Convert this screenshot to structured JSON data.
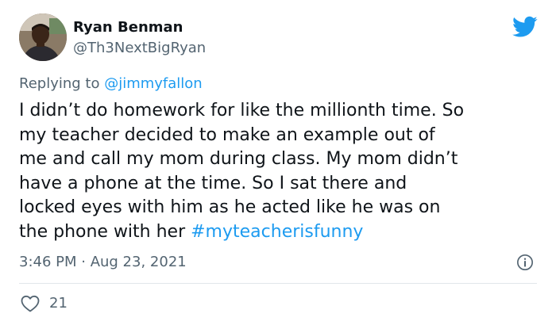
{
  "author": {
    "name": "Ryan Benman",
    "handle": "@Th3NextBigRyan"
  },
  "reply": {
    "prefix": "Replying to ",
    "mention": "@jimmyfallon"
  },
  "tweet": {
    "lines": [
      "I didn’t do homework for like the millionth time. So",
      "my teacher decided to make an example out of",
      "me and call my mom during class. My mom didn’t",
      "have a phone at the time. So I sat there and",
      "locked eyes with him as he acted like he was on",
      "the phone with her "
    ],
    "hashtag": "#myteacherisfunny"
  },
  "timestamp": "3:46 PM · Aug 23, 2021",
  "likes": "21",
  "icons": {
    "logo": "twitter-bird-icon",
    "info": "info-icon",
    "like": "heart-icon"
  },
  "colors": {
    "accent": "#1d9bf0",
    "text": "#0f1419",
    "muted": "#536471",
    "divider": "#e1e6ea"
  }
}
